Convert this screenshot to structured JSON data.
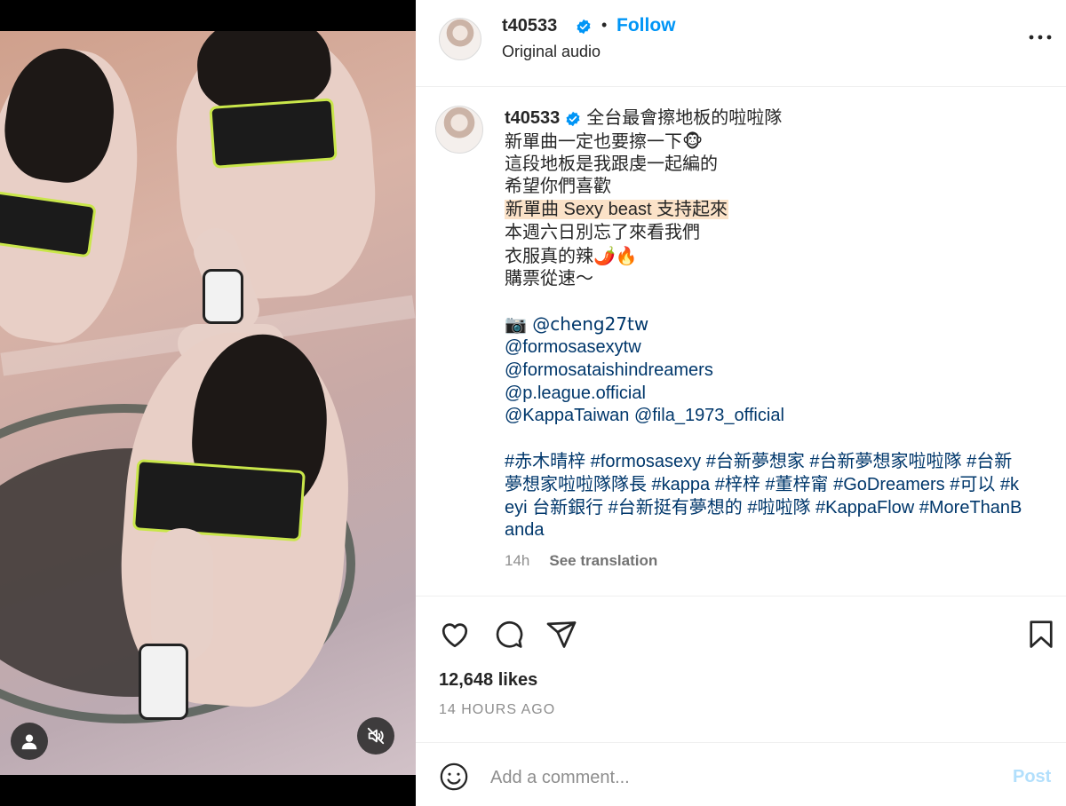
{
  "post": {
    "author": "t40533",
    "verified": true,
    "follow_label": "Follow",
    "separator": "•",
    "audio_label": "Original audio"
  },
  "caption": {
    "author": "t40533",
    "lines": [
      "全台最會擦地板的啦啦隊",
      "新單曲一定也要擦一下🐵",
      "這段地板是我跟虔一起編的",
      "希望你們喜歡",
      "新單曲 Sexy beast 支持起來",
      "本週六日別忘了來看我們",
      "衣服真的辣🌶️🔥",
      "購票從速～"
    ],
    "mentions": [
      "📷 @cheng27tw",
      "@formosasexytw",
      "@formosataishindreamers",
      "@p.league.official",
      "@KappaTaiwan @fila_1973_official"
    ],
    "hashtags": "#赤木晴梓 #formosasexy #台新夢想家 #台新夢想家啦啦隊 #台新夢想家啦啦隊隊長 #kappa #梓梓 #董梓甯 #GoDreamers #可以 #keyi 台新銀行 #台新挺有夢想的 #啦啦隊 #KappaFlow #MoreThanBanda",
    "age": "14h",
    "see_translation": "See translation"
  },
  "actions": {
    "likes": "12,648 likes",
    "timestamp": "14 HOURS AGO"
  },
  "comment": {
    "placeholder": "Add a comment...",
    "post_label": "Post"
  },
  "icons": {
    "verified": "verified-badge-icon",
    "more": "more-options-icon",
    "like": "heart-icon",
    "comment": "comment-bubble-icon",
    "share": "paper-plane-icon",
    "save": "bookmark-icon",
    "emoji": "smiley-icon",
    "user_tag": "person-icon",
    "mute": "speaker-muted-icon"
  },
  "colors": {
    "link": "#00376b",
    "follow": "#0095f6",
    "post_disabled": "#b2dffc",
    "verified": "#0095f6",
    "highlight": "#fbe2c8"
  }
}
